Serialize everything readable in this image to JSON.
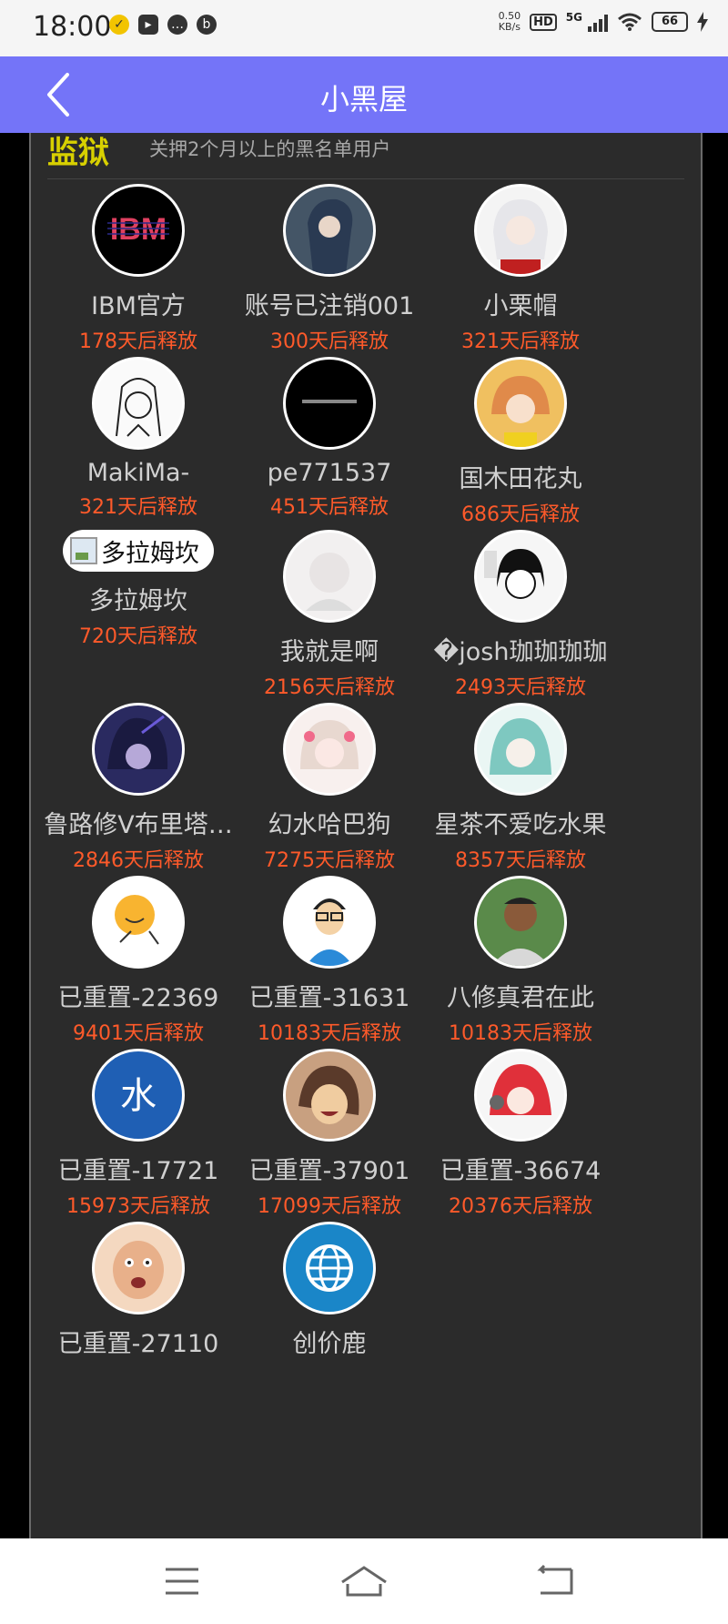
{
  "status_bar": {
    "time": "18:00",
    "speed_top": "0.50",
    "speed_unit": "KB/s",
    "hd": "HD",
    "network": "5G",
    "battery": "66"
  },
  "header": {
    "title": "小黑屋"
  },
  "section": {
    "title": "监狱",
    "description": "关押2个月以上的黑名单用户"
  },
  "users": [
    {
      "name": "IBM官方",
      "release": "178天后释放",
      "avatar": "ibm-logo"
    },
    {
      "name": "账号已注销001",
      "release": "300天后释放",
      "avatar": "anime-girl-dark"
    },
    {
      "name": "小栗帽",
      "release": "321天后释放",
      "avatar": "anime-girl-silver"
    },
    {
      "name": "MakiMa-",
      "release": "321天后释放",
      "avatar": "manga-girl"
    },
    {
      "name": "pe771537",
      "release": "451天后释放",
      "avatar": "black-text"
    },
    {
      "name": "国木田花丸",
      "release": "686天后释放",
      "avatar": "anime-girl-orange"
    },
    {
      "name": "多拉姆坎",
      "release": "720天后释放",
      "avatar": "broken-image",
      "alt": "多拉姆坎"
    },
    {
      "name": "我就是啊",
      "release": "2156天后释放",
      "avatar": "anime-sketch"
    },
    {
      "name": "�josh珈珈珈珈",
      "release": "2493天后释放",
      "avatar": "manga-boy"
    },
    {
      "name": "鲁路修V布里塔…",
      "release": "2846天后释放",
      "avatar": "anime-boy-purple"
    },
    {
      "name": "幻水哈巴狗",
      "release": "7275天后释放",
      "avatar": "anime-girl-pink"
    },
    {
      "name": "星茶不爱吃水果",
      "release": "8357天后释放",
      "avatar": "anime-girl-teal"
    },
    {
      "name": "已重置-22369",
      "release": "9401天后释放",
      "avatar": "smiley-ball"
    },
    {
      "name": "已重置-31631",
      "release": "10183天后释放",
      "avatar": "cartoon-man"
    },
    {
      "name": "八修真君在此",
      "release": "10183天后释放",
      "avatar": "photo-man"
    },
    {
      "name": "已重置-17721",
      "release": "15973天后释放",
      "avatar": "water-logo"
    },
    {
      "name": "已重置-37901",
      "release": "17099天后释放",
      "avatar": "anime-face-laugh"
    },
    {
      "name": "已重置-36674",
      "release": "20376天后释放",
      "avatar": "anime-girl-red"
    },
    {
      "name": "已重置-27110",
      "release": "",
      "avatar": "meme-face"
    },
    {
      "name": "创价鹿",
      "release": "",
      "avatar": "globe-icon"
    }
  ],
  "nav": {
    "menu": "menu-icon",
    "home": "home-icon",
    "back": "back-icon"
  }
}
